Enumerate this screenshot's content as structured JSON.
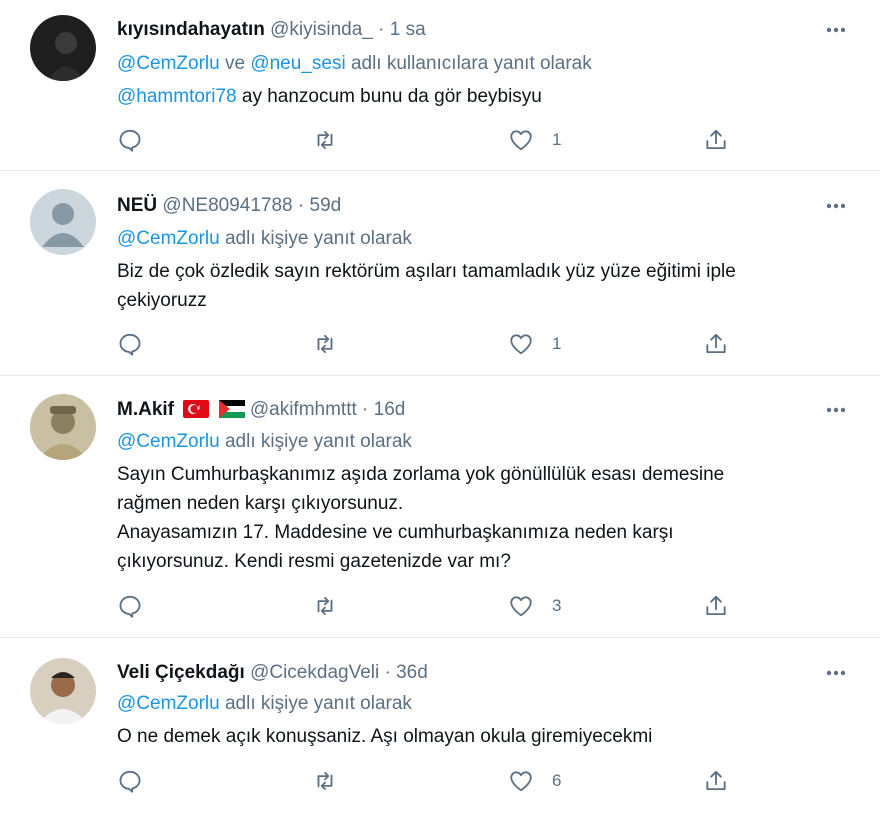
{
  "tweets": [
    {
      "name": "kıyısındahayatın",
      "handle": "@kiyisinda_",
      "sep": "·",
      "time": "1 sa",
      "reply_mentions": [
        "@CemZorlu",
        "@neu_sesi"
      ],
      "reply_join": " ve ",
      "reply_suffix": " adlı kullanıcılara yanıt olarak",
      "body_mention": "@hammtori78",
      "body_lines": [
        " ay hanzocum bunu da gör beybisyu"
      ],
      "likes": "1"
    },
    {
      "name": "NEÜ",
      "handle": "@NE80941788",
      "sep": "·",
      "time": "59d",
      "reply_mentions": [
        "@CemZorlu"
      ],
      "reply_suffix": " adlı kişiye yanıt olarak",
      "body_lines": [
        "Biz de çok özledik sayın rektörüm aşıları tamamladık yüz yüze eğitimi iple",
        "çekiyoruzz"
      ],
      "likes": "1"
    },
    {
      "name": "M.Akif",
      "handle": "@akifmhmttt",
      "sep": "·",
      "time": "16d",
      "flags": [
        "turkey-flag",
        "palestine-flag"
      ],
      "reply_mentions": [
        "@CemZorlu"
      ],
      "reply_suffix": " adlı kişiye yanıt olarak",
      "body_lines": [
        "Sayın Cumhurbaşkanımız aşıda zorlama yok gönüllülük esası demesine",
        "rağmen neden karşı çıkıyorsunuz.",
        "Anayasamızın 17. Maddesine ve cumhurbaşkanımıza neden karşı",
        "çıkıyorsunuz. Kendi resmi gazetenizde var mı?"
      ],
      "likes": "3"
    },
    {
      "name": "Veli Çiçekdağı",
      "handle": "@CicekdagVeli",
      "sep": "·",
      "time": "36d",
      "reply_mentions": [
        "@CemZorlu"
      ],
      "reply_suffix": " adlı kişiye yanıt olarak",
      "body_lines": [
        "O ne demek açık konuşsaniz. Aşı olmayan okula giremiyecekmi"
      ],
      "likes": "6"
    }
  ],
  "icons": {
    "reply": "reply-icon",
    "retweet": "retweet-icon",
    "like": "like-icon",
    "share": "share-icon",
    "more": "more-icon"
  },
  "colors": {
    "link": "#1b95e0",
    "secondary_text": "#5b7083",
    "divider": "#e6ecf0"
  }
}
